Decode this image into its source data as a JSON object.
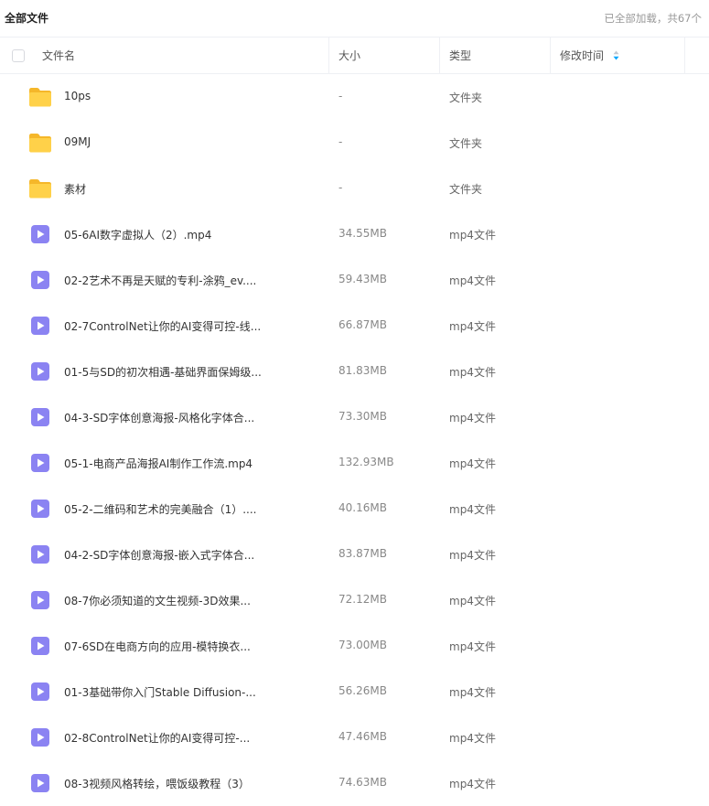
{
  "topbar": {
    "title": "全部文件",
    "status": "已全部加载，共67个"
  },
  "header": {
    "col_name": "文件名",
    "col_size": "大小",
    "col_type": "类型",
    "col_mtime": "修改时间",
    "sort_icon": "sort-arrows-icon"
  },
  "icons": {
    "folder": "folder-icon",
    "video": "video-file-icon"
  },
  "colors": {
    "folder": "#FFC933",
    "video": "#8B83F2",
    "sort_active": "#06A7FF"
  },
  "files": [
    {
      "kind": "folder",
      "name": "10ps",
      "size": "-",
      "type": "文件夹"
    },
    {
      "kind": "folder",
      "name": "09MJ",
      "size": "-",
      "type": "文件夹"
    },
    {
      "kind": "folder",
      "name": "素材",
      "size": "-",
      "type": "文件夹"
    },
    {
      "kind": "video",
      "name": "05-6AI数字虚拟人（2）.mp4",
      "size": "34.55MB",
      "type": "mp4文件"
    },
    {
      "kind": "video",
      "name": "02-2艺术不再是天赋的专利-涂鸦_ev....",
      "size": "59.43MB",
      "type": "mp4文件"
    },
    {
      "kind": "video",
      "name": "02-7ControlNet让你的AI变得可控-线...",
      "size": "66.87MB",
      "type": "mp4文件"
    },
    {
      "kind": "video",
      "name": "01-5与SD的初次相遇-基础界面保姆级...",
      "size": "81.83MB",
      "type": "mp4文件"
    },
    {
      "kind": "video",
      "name": "04-3-SD字体创意海报-风格化字体合...",
      "size": "73.30MB",
      "type": "mp4文件"
    },
    {
      "kind": "video",
      "name": "05-1-电商产品海报AI制作工作流.mp4",
      "size": "132.93MB",
      "type": "mp4文件"
    },
    {
      "kind": "video",
      "name": "05-2-二维码和艺术的完美融合（1）....",
      "size": "40.16MB",
      "type": "mp4文件"
    },
    {
      "kind": "video",
      "name": "04-2-SD字体创意海报-嵌入式字体合...",
      "size": "83.87MB",
      "type": "mp4文件"
    },
    {
      "kind": "video",
      "name": "08-7你必须知道的文生视频-3D效果...",
      "size": "72.12MB",
      "type": "mp4文件"
    },
    {
      "kind": "video",
      "name": "07-6SD在电商方向的应用-模特换衣...",
      "size": "73.00MB",
      "type": "mp4文件"
    },
    {
      "kind": "video",
      "name": "01-3基础带你入门Stable Diffusion-...",
      "size": "56.26MB",
      "type": "mp4文件"
    },
    {
      "kind": "video",
      "name": "02-8ControlNet让你的AI变得可控-...",
      "size": "47.46MB",
      "type": "mp4文件"
    },
    {
      "kind": "video",
      "name": "08-3视频风格转绘，喂饭级教程（3）",
      "size": "74.63MB",
      "type": "mp4文件"
    }
  ]
}
